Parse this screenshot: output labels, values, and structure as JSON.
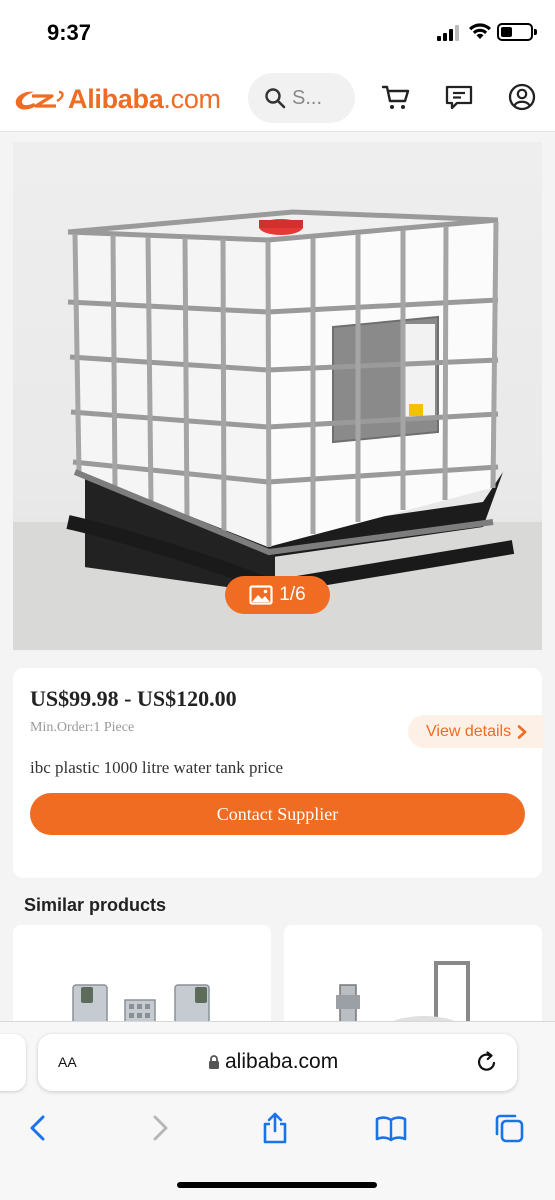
{
  "status_bar": {
    "time": "9:37"
  },
  "header": {
    "logo_main": "Alibaba",
    "logo_suffix": ".com",
    "search_placeholder": "S...",
    "icons": [
      "cart-icon",
      "message-icon",
      "account-icon"
    ]
  },
  "product": {
    "image_counter": "1/6",
    "price_range": "US$99.98 - US$120.00",
    "min_order": "Min.Order:1 Piece",
    "view_details_label": "View details",
    "title": "ibc plastic 1000 litre water tank price",
    "contact_button_label": "Contact Supplier"
  },
  "similar": {
    "heading": "Similar products"
  },
  "safari": {
    "text_size_label": "AA",
    "url": "alibaba.com",
    "toolbar": [
      "back-icon",
      "forward-icon",
      "share-icon",
      "bookmarks-icon",
      "tabs-icon"
    ]
  },
  "colors": {
    "brand": "#ef6c22",
    "brand_light": "#fdf0e6",
    "ios_blue": "#1a73e8"
  }
}
